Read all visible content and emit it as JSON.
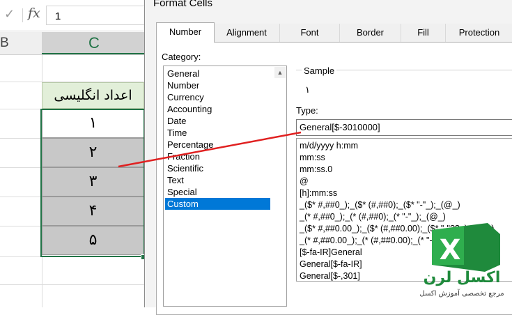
{
  "formula_bar": {
    "cancel_icon": "✓",
    "fx_label": "fx",
    "value": "1"
  },
  "sheet": {
    "column_b": "B",
    "column_c": "C",
    "header_cell": "اعداد انگلیسی",
    "cells": [
      "۱",
      "۲",
      "۳",
      "۴",
      "۵"
    ]
  },
  "dialog": {
    "title": "Format Cells",
    "tabs": [
      "Number",
      "Alignment",
      "Font",
      "Border",
      "Fill",
      "Protection"
    ],
    "active_tab": "Number",
    "category_label": "Category:",
    "categories": [
      "General",
      "Number",
      "Currency",
      "Accounting",
      "Date",
      "Time",
      "Percentage",
      "Fraction",
      "Scientific",
      "Text",
      "Special",
      "Custom"
    ],
    "selected_category": "Custom",
    "sample_label": "Sample",
    "sample_value": "۱",
    "type_label": "Type:",
    "type_value": "General[$-3010000]",
    "type_list": [
      "m/d/yyyy h:mm",
      "mm:ss",
      "mm:ss.0",
      "@",
      "[h]:mm:ss",
      "_($* #,##0_);_($* (#,##0);_($* \"-\"_);_(@_)",
      "_(* #,##0_);_(* (#,##0);_(* \"-\"_);_(@_)",
      "_($* #,##0.00_);_($* (#,##0.00);_($* \"-\"??_);_(@_)",
      "_(* #,##0.00_);_(* (#,##0.00);_(* \"-\"??_);_(@_)",
      "[$-fa-IR]General",
      "General[$-fa-IR]",
      "General[$-,301]"
    ]
  },
  "logo": {
    "brand": "اکسل لرن",
    "tagline": "مرجع تخصصی آموزش اکسل",
    "letter": "X"
  },
  "colors": {
    "excel_green": "#217346",
    "selection_blue": "#0078d7",
    "arrow_red": "#e02020"
  }
}
